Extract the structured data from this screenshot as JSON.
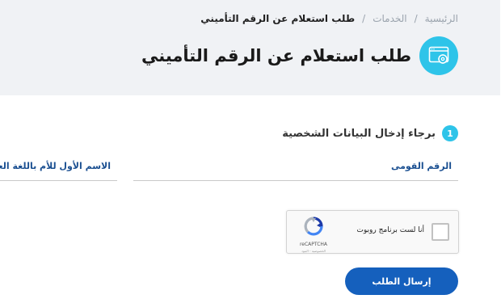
{
  "breadcrumb": {
    "home": "الرئيسية",
    "services": "الخدمات",
    "separator": "/",
    "current": "طلب استعلام عن الرقم التأميني"
  },
  "page": {
    "title": "طلب استعلام عن الرقم التأميني",
    "icon": "browser-settings-icon",
    "accent_color": "#2ec4e9",
    "primary_color": "#1560bd"
  },
  "step": {
    "number": "1",
    "label": "برجاء إدخال البيانات الشخصية"
  },
  "form": {
    "national_id_label": "الرقم القومى",
    "mother_first_name_label": "الاسم الأول للأم باللغة العربية",
    "submit_label": "إرسال الطلب"
  },
  "recaptcha": {
    "text": "أنا لست برنامج روبوت",
    "brand": "reCAPTCHA",
    "links": "الخصوصية - البنود",
    "icon": "recaptcha-logo-icon"
  }
}
